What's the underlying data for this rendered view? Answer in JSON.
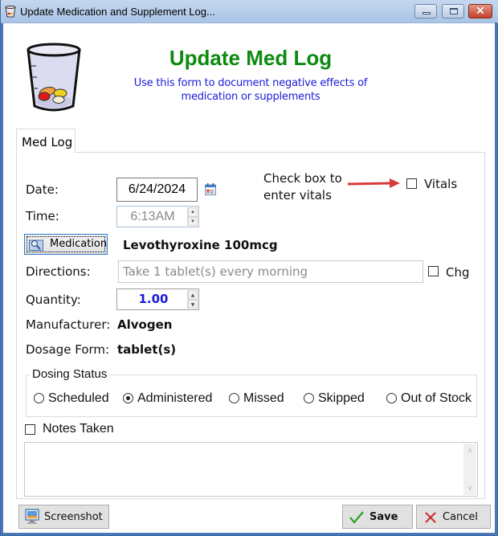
{
  "window": {
    "title": "Update Medication and Supplement Log...",
    "controls": {
      "minimize": "minimize",
      "maximize": "maximize",
      "close": "✕"
    }
  },
  "header": {
    "title": "Update Med Log",
    "subtitle_line1": "Use this form to document negative effects of",
    "subtitle_line2": "medication or supplements",
    "title_color": "#0d8a10",
    "subtitle_color": "#1a1adb"
  },
  "tabs": [
    {
      "label": "Med Log",
      "active": true
    }
  ],
  "form": {
    "date_label": "Date:",
    "date_value": "6/24/2024",
    "time_label": "Time:",
    "time_value": "6:13AM",
    "vitals_note_line1": "Check box to",
    "vitals_note_line2": "enter vitals",
    "vitals_label": "Vitals",
    "vitals_checked": false,
    "medication_button": "Medication",
    "medication_value": "Levothyroxine 100mcg",
    "directions_label": "Directions:",
    "directions_value": "Take 1 tablet(s) every morning",
    "chg_label": "Chg",
    "chg_checked": false,
    "quantity_label": "Quantity:",
    "quantity_value": "1.00",
    "manufacturer_label": "Manufacturer:",
    "manufacturer_value": "Alvogen",
    "dosage_form_label": "Dosage Form:",
    "dosage_form_value": "tablet(s)"
  },
  "dosing_status": {
    "legend": "Dosing Status",
    "options": [
      {
        "label": "Scheduled",
        "selected": false
      },
      {
        "label": "Administered",
        "selected": true
      },
      {
        "label": "Missed",
        "selected": false
      },
      {
        "label": "Skipped",
        "selected": false
      },
      {
        "label": "Out of Stock",
        "selected": false
      }
    ]
  },
  "notes": {
    "label": "Notes Taken",
    "checked": false,
    "value": ""
  },
  "footer": {
    "screenshot_button": "Screenshot",
    "save_button": "Save",
    "cancel_button": "Cancel"
  }
}
